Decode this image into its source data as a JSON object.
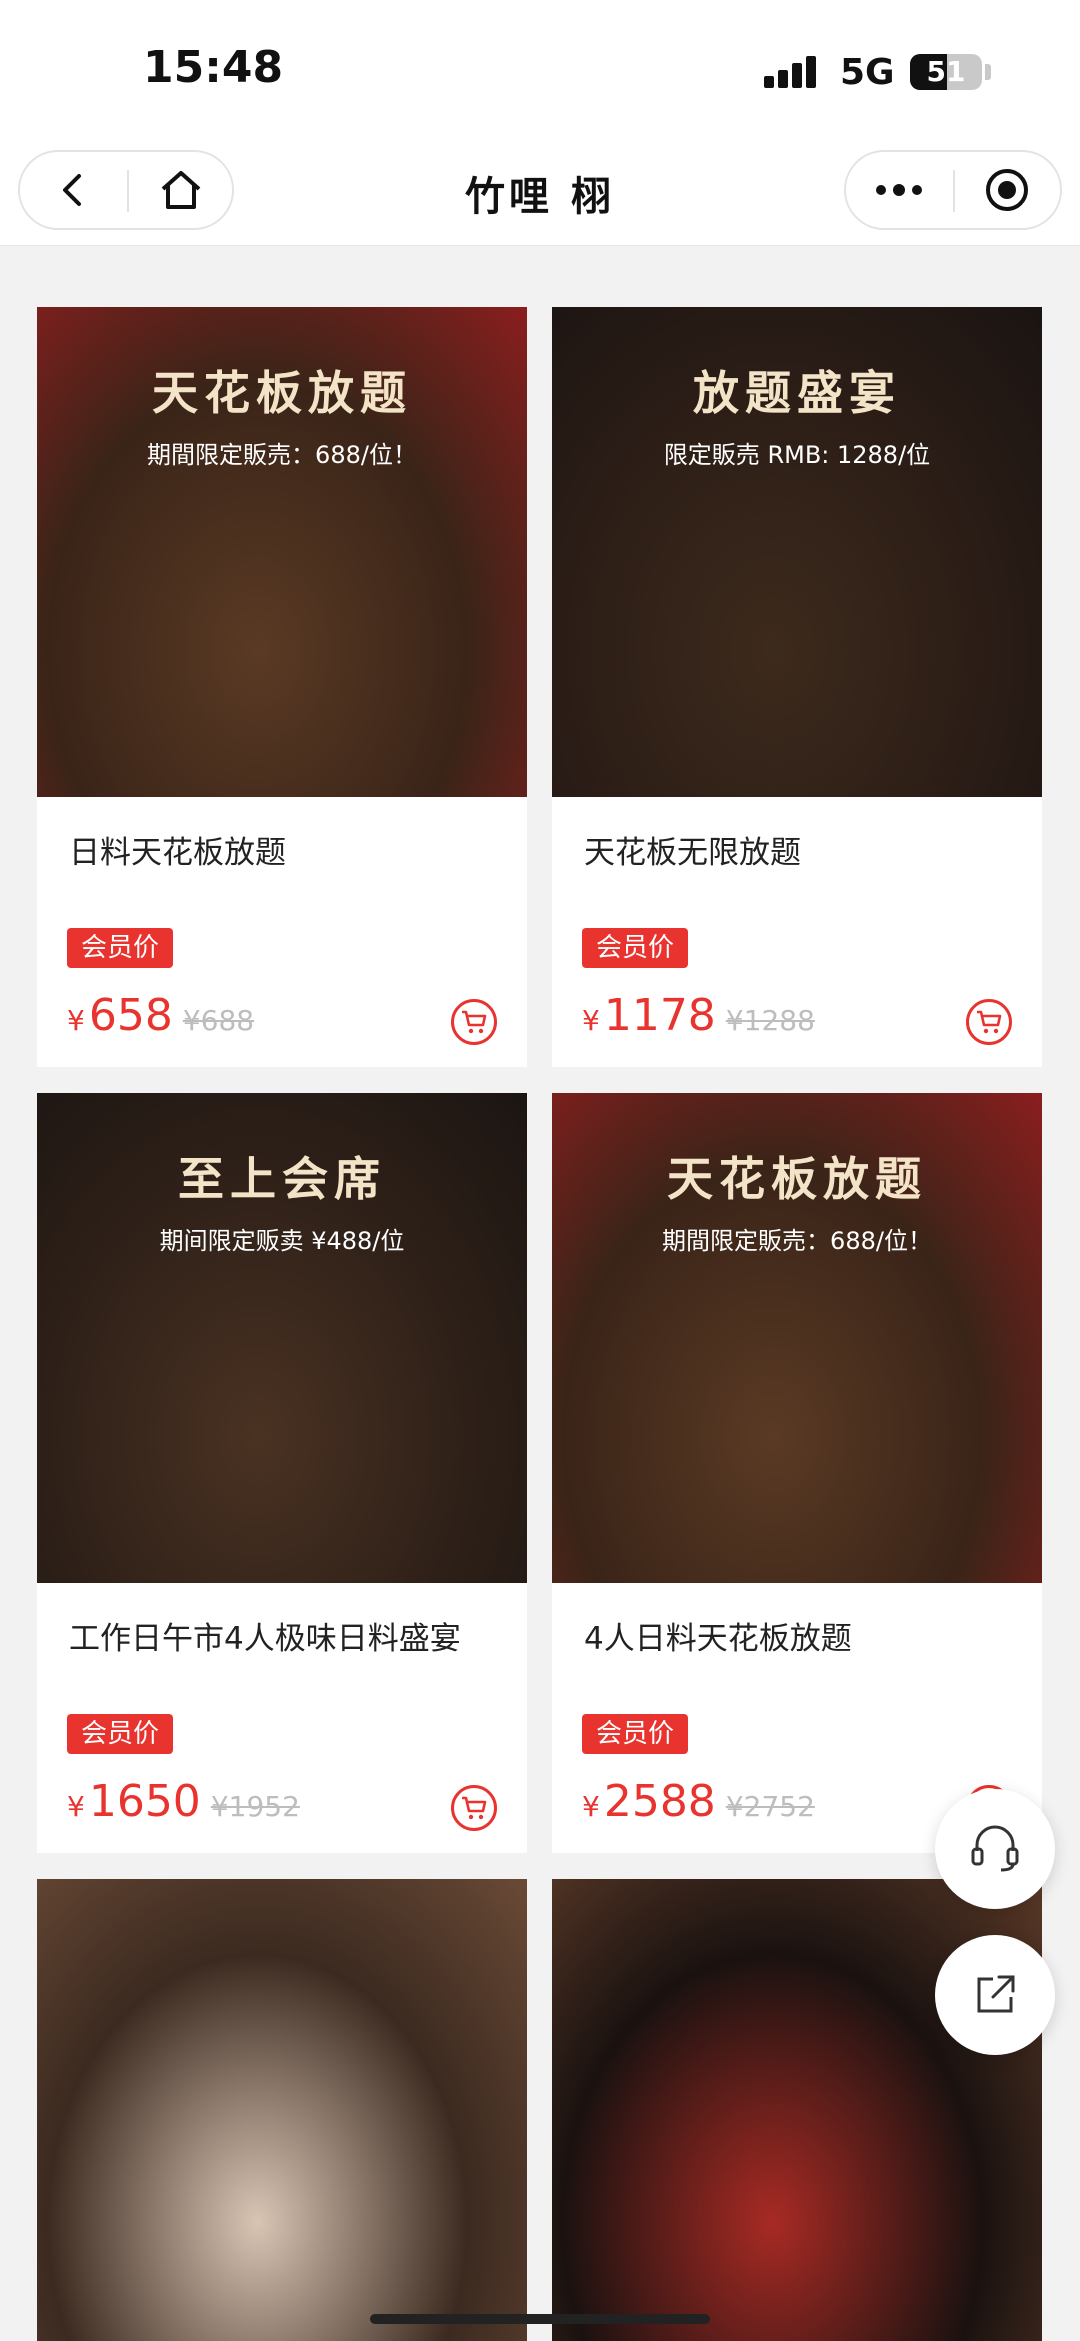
{
  "status_bar": {
    "time": "15:48",
    "network": "5G",
    "battery": "51",
    "battery_level": 0.51
  },
  "nav": {
    "title": "竹哩 栩",
    "back_icon": "chevron-left-icon",
    "home_icon": "home-icon",
    "more_icon": "more-dots-icon",
    "close_icon": "capsule-close-icon"
  },
  "products": [
    {
      "name": "日料天花板放题",
      "tag": "会员价",
      "currency": "¥",
      "price": "658",
      "original_price": "¥688",
      "image": {
        "headline": "天花板放题",
        "sub": "期間限定販売：688/位！",
        "colors": [
          "#8b1e1e",
          "#3a2418",
          "#5a3a24"
        ]
      }
    },
    {
      "name": "天花板无限放题",
      "tag": "会员价",
      "currency": "¥",
      "price": "1178",
      "original_price": "¥1288",
      "image": {
        "headline": "放题盛宴",
        "sub": "限定販売 RMB: 1288/位",
        "colors": [
          "#1a1412",
          "#2b1d16",
          "#3d2a1c"
        ]
      }
    },
    {
      "name": "工作日午市4人极味日料盛宴",
      "tag": "会员价",
      "currency": "¥",
      "price": "1650",
      "original_price": "¥1952",
      "image": {
        "headline": "至上会席",
        "sub": "期间限定贩卖 ¥488/位",
        "colors": [
          "#1b1512",
          "#2e2018",
          "#4a3222"
        ]
      }
    },
    {
      "name": "4人日料天花板放题",
      "tag": "会员价",
      "currency": "¥",
      "price": "2588",
      "original_price": "¥2752",
      "image": {
        "headline": "天花板放题",
        "sub": "期間限定販売：688/位！",
        "colors": [
          "#8b1e1e",
          "#3a2418",
          "#5a3a24"
        ]
      }
    },
    {
      "image": {
        "headline": "",
        "sub": "",
        "colors": [
          "#6a4a36",
          "#3c2a20",
          "#d9c5b4"
        ]
      }
    },
    {
      "image": {
        "headline": "",
        "sub": "",
        "colors": [
          "#5c3a28",
          "#1a1210",
          "#a82a24"
        ]
      }
    }
  ],
  "floating": {
    "service_icon": "headset-icon",
    "share_icon": "share-icon"
  }
}
